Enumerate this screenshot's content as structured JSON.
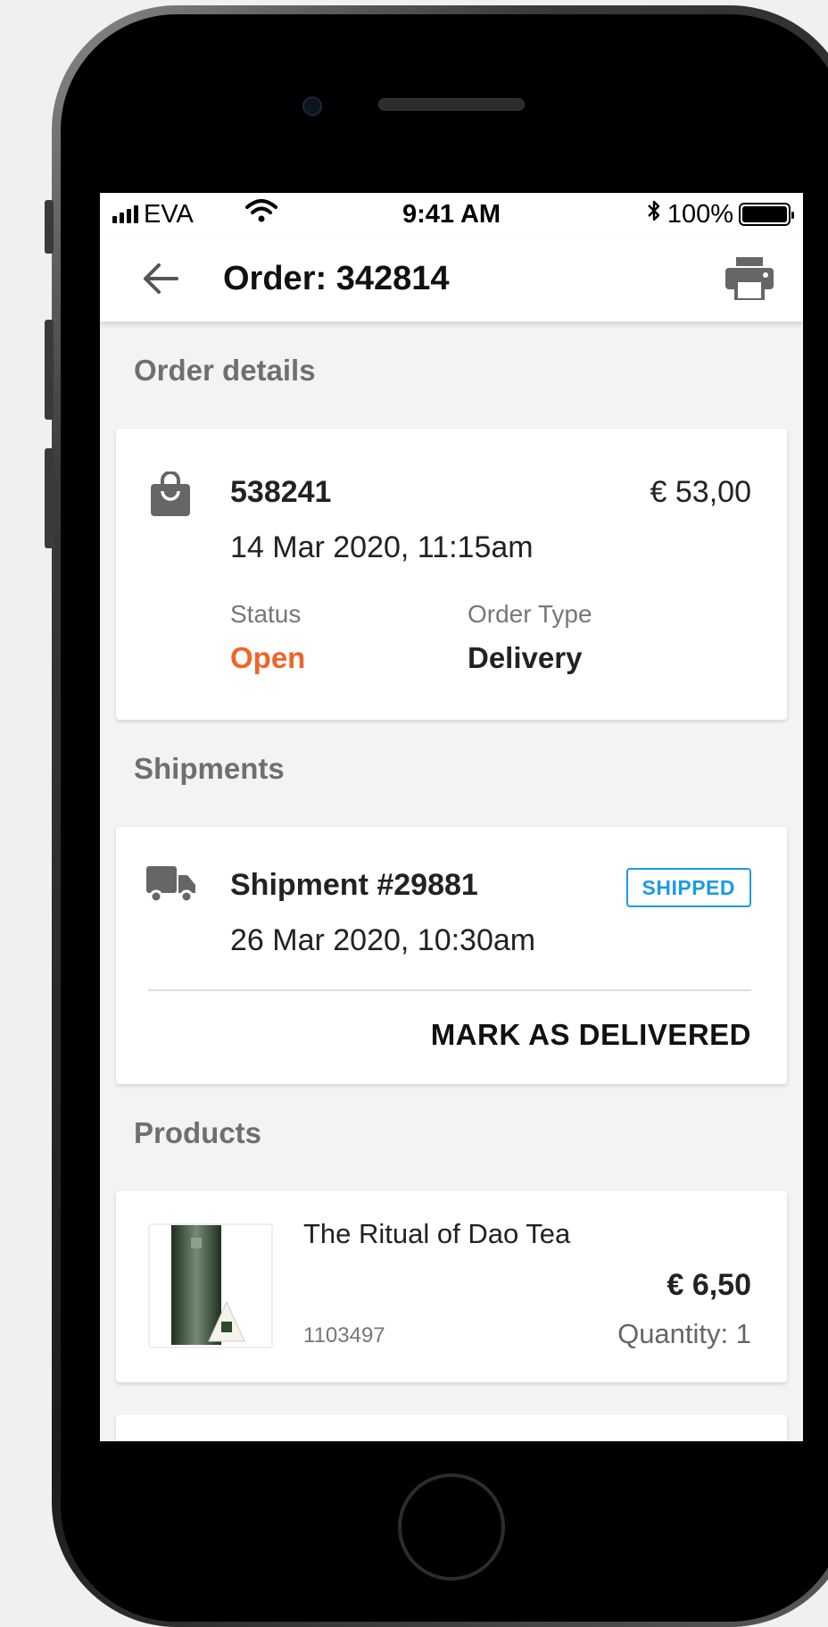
{
  "status_bar": {
    "carrier": "EVA",
    "time": "9:41 AM",
    "battery_text": "100%",
    "battery_level": 1.0
  },
  "app_bar": {
    "title": "Order: 342814"
  },
  "order_details": {
    "section_title": "Order details",
    "order_number": "538241",
    "amount": "€ 53,00",
    "date": "14 Mar 2020, 11:15am",
    "status_label": "Status",
    "status_value": "Open",
    "type_label": "Order Type",
    "type_value": "Delivery"
  },
  "shipments": {
    "section_title": "Shipments",
    "title": "Shipment #29881",
    "badge": "SHIPPED",
    "date": "26 Mar 2020, 10:30am",
    "action": "MARK AS DELIVERED"
  },
  "products": {
    "section_title": "Products",
    "items": [
      {
        "name": "The Ritual of Dao Tea",
        "price": "€ 6,50",
        "sku": "1103497",
        "quantity": "Quantity: 1"
      }
    ]
  },
  "colors": {
    "status_open": "#f0642a",
    "badge_blue": "#1c9be6"
  },
  "icons": [
    "back-arrow-icon",
    "printer-icon",
    "shopping-bag-icon",
    "truck-icon",
    "wifi-icon",
    "bluetooth-icon",
    "battery-icon",
    "signal-icon"
  ]
}
